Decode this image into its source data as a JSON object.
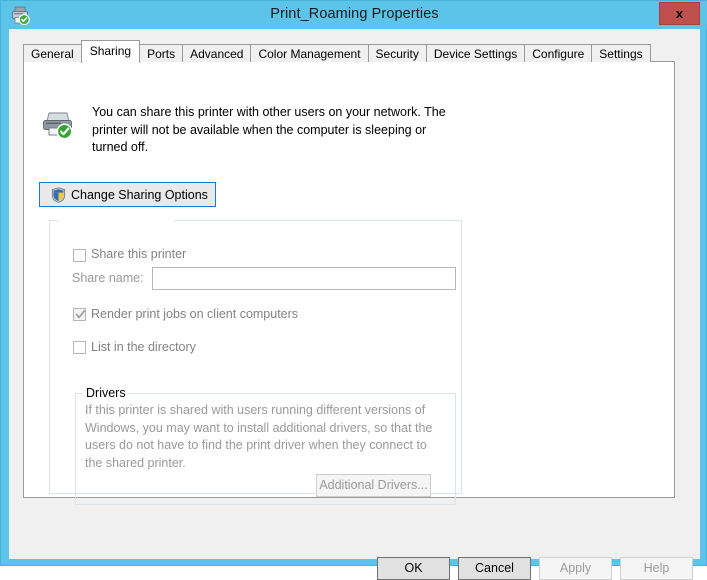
{
  "window": {
    "title": "Print_Roaming Properties",
    "icon": "printer-shared-icon",
    "close_label": "x",
    "titlebar_color": "#5bc4e8",
    "close_button_color": "#c0504d"
  },
  "tabs": [
    {
      "label": "General",
      "active": false
    },
    {
      "label": "Sharing",
      "active": true
    },
    {
      "label": "Ports",
      "active": false
    },
    {
      "label": "Advanced",
      "active": false
    },
    {
      "label": "Color Management",
      "active": false
    },
    {
      "label": "Security",
      "active": false
    },
    {
      "label": "Device Settings",
      "active": false
    },
    {
      "label": "Configure",
      "active": false
    },
    {
      "label": "Settings",
      "active": false
    }
  ],
  "sharing": {
    "info_icon": "printer-check-icon",
    "info_text": "You can share this printer with other users on your network. The printer will not be available when the computer is sleeping or turned off.",
    "change_button": {
      "label": "Change Sharing Options",
      "icon": "uac-shield-icon"
    },
    "share_checkbox": {
      "label": "Share this printer",
      "checked": false,
      "enabled": false
    },
    "share_name": {
      "label": "Share name:",
      "value": "",
      "placeholder": "",
      "enabled": false
    },
    "render_checkbox": {
      "label": "Render print jobs on client computers",
      "checked": true,
      "enabled": false
    },
    "list_directory_checkbox": {
      "label": "List in the directory",
      "checked": false,
      "enabled": false
    },
    "drivers": {
      "caption": "Drivers",
      "description": "If this printer is shared with users running different versions of Windows, you may want to install additional drivers, so that the users do not have to find the print driver when they connect to the shared printer.",
      "button_label": "Additional Drivers...",
      "button_enabled": false
    }
  },
  "dialog_buttons": [
    {
      "label": "OK",
      "enabled": true
    },
    {
      "label": "Cancel",
      "enabled": true
    },
    {
      "label": "Apply",
      "enabled": false
    },
    {
      "label": "Help",
      "enabled": false
    }
  ]
}
